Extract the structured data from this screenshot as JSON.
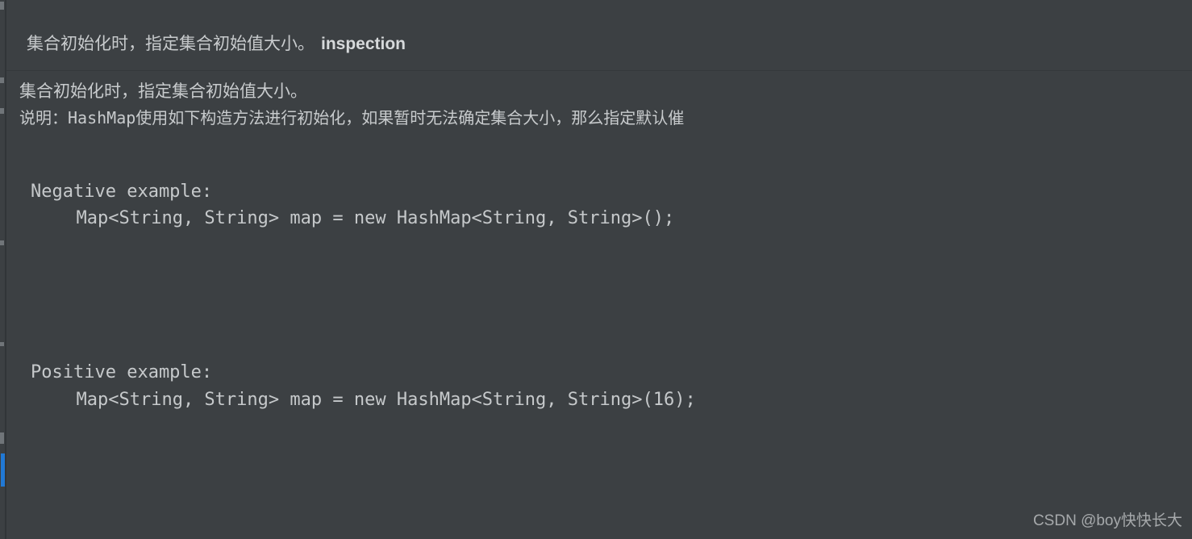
{
  "theme": {
    "background": "#3c4043",
    "text": "#c8cbcd",
    "code_text": "#c6c9cb",
    "header_rule": "#34383b",
    "gutter_line": "#313538",
    "gutter_highlight": "#2179d5",
    "watermark_text": "#b9bcbe"
  },
  "popup": {
    "title_text": "集合初始化时，指定集合初始值大小。",
    "title_inspection_label": "inspection",
    "description": [
      "集合初始化时，指定集合初始值大小。",
      "说明：HashMap使用如下构造方法进行初始化，如果暂时无法确定集合大小，那么指定默认催"
    ],
    "examples": [
      {
        "label": "Negative example:",
        "code": "  Map<String, String> map = new HashMap<String, String>();"
      },
      {
        "label": "Positive example:",
        "code": "  Map<String, String> map = new HashMap<String, String>(16);"
      }
    ]
  },
  "gutter": {
    "highlight_present": true
  },
  "watermark": {
    "text": "CSDN @boy快快长大"
  }
}
